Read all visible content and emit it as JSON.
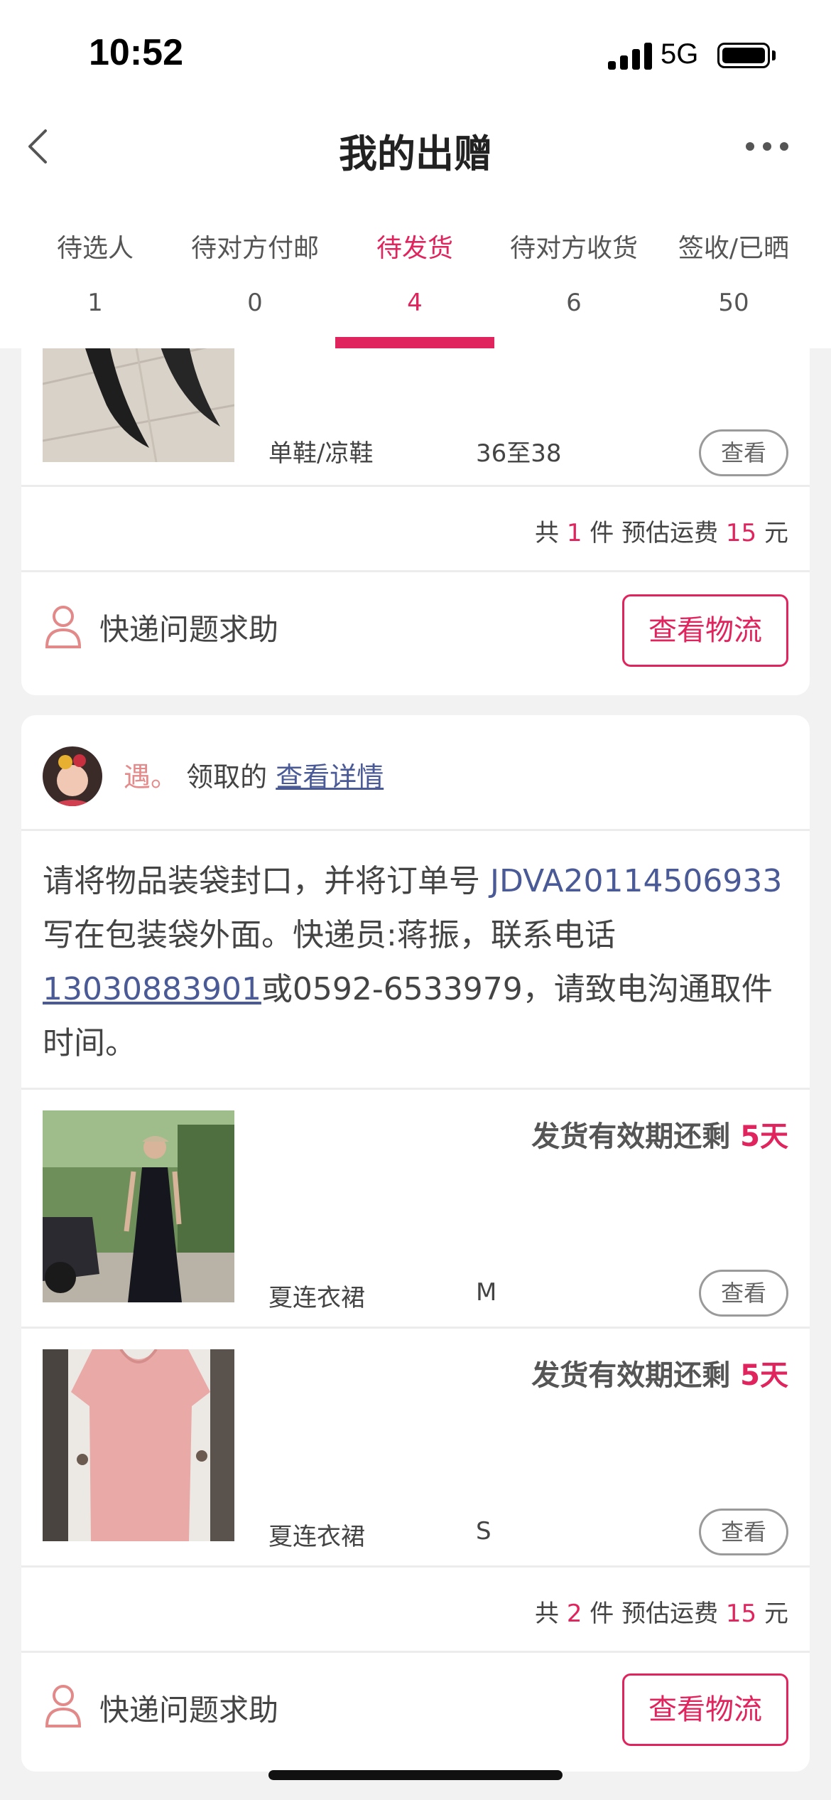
{
  "status_bar": {
    "time": "10:52",
    "network": "5G"
  },
  "header": {
    "title": "我的出赠",
    "back_icon": "chevron-left-icon",
    "more_icon": "more-dots-icon"
  },
  "tabs": [
    {
      "label": "待选人",
      "count": "1"
    },
    {
      "label": "待对方付邮",
      "count": "0"
    },
    {
      "label": "待发货",
      "count": "4",
      "active": true
    },
    {
      "label": "待对方收货",
      "count": "6"
    },
    {
      "label": "签收/已晒",
      "count": "50"
    }
  ],
  "colors": {
    "accent": "#e0245e",
    "link": "#4a5a96",
    "nick": "#e58a8a"
  },
  "card1": {
    "item": {
      "name": "单鞋/凉鞋",
      "size": "36至38",
      "view_label": "查看"
    },
    "summary": {
      "pre": "共 ",
      "count": "1",
      "mid": " 件 预估运费 ",
      "fee": "15",
      "post": " 元"
    },
    "help_label": "快递问题求助",
    "logistics_label": "查看物流"
  },
  "card2": {
    "receiver": {
      "nickname": "遇。",
      "verb": " 领取的 ",
      "detail_link": "查看详情"
    },
    "instruction": {
      "part1": "请将物品装袋封口，并将订单号 ",
      "order_no": "JDVA20114506933",
      "part2": " 写在包装袋外面。快递员:蒋振，联系电话",
      "phone": "13030883901",
      "part3": "或0592-6533979，请致电沟通取件时间。"
    },
    "items": [
      {
        "deadline_label": "发货有效期还剩 ",
        "days": "5天",
        "name": "夏连衣裙",
        "size": "M",
        "view_label": "查看"
      },
      {
        "deadline_label": "发货有效期还剩 ",
        "days": "5天",
        "name": "夏连衣裙",
        "size": "S",
        "view_label": "查看"
      }
    ],
    "summary": {
      "pre": "共 ",
      "count": "2",
      "mid": " 件 预估运费 ",
      "fee": "15",
      "post": " 元"
    },
    "help_label": "快递问题求助",
    "logistics_label": "查看物流"
  }
}
